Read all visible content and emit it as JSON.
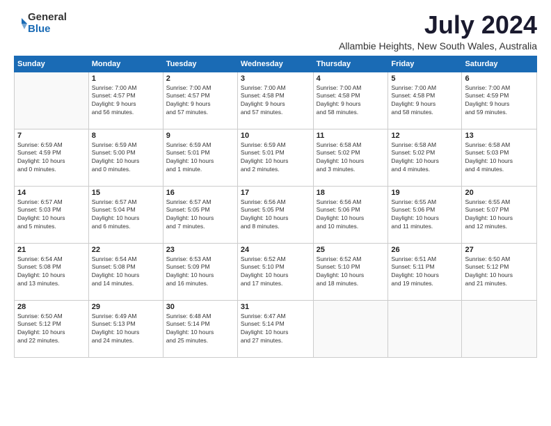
{
  "logo": {
    "general": "General",
    "blue": "Blue"
  },
  "title": "July 2024",
  "subtitle": "Allambie Heights, New South Wales, Australia",
  "weekdays": [
    "Sunday",
    "Monday",
    "Tuesday",
    "Wednesday",
    "Thursday",
    "Friday",
    "Saturday"
  ],
  "weeks": [
    [
      {
        "day": "",
        "info": ""
      },
      {
        "day": "1",
        "info": "Sunrise: 7:00 AM\nSunset: 4:57 PM\nDaylight: 9 hours\nand 56 minutes."
      },
      {
        "day": "2",
        "info": "Sunrise: 7:00 AM\nSunset: 4:57 PM\nDaylight: 9 hours\nand 57 minutes."
      },
      {
        "day": "3",
        "info": "Sunrise: 7:00 AM\nSunset: 4:58 PM\nDaylight: 9 hours\nand 57 minutes."
      },
      {
        "day": "4",
        "info": "Sunrise: 7:00 AM\nSunset: 4:58 PM\nDaylight: 9 hours\nand 58 minutes."
      },
      {
        "day": "5",
        "info": "Sunrise: 7:00 AM\nSunset: 4:58 PM\nDaylight: 9 hours\nand 58 minutes."
      },
      {
        "day": "6",
        "info": "Sunrise: 7:00 AM\nSunset: 4:59 PM\nDaylight: 9 hours\nand 59 minutes."
      }
    ],
    [
      {
        "day": "7",
        "info": "Sunrise: 6:59 AM\nSunset: 4:59 PM\nDaylight: 10 hours\nand 0 minutes."
      },
      {
        "day": "8",
        "info": "Sunrise: 6:59 AM\nSunset: 5:00 PM\nDaylight: 10 hours\nand 0 minutes."
      },
      {
        "day": "9",
        "info": "Sunrise: 6:59 AM\nSunset: 5:01 PM\nDaylight: 10 hours\nand 1 minute."
      },
      {
        "day": "10",
        "info": "Sunrise: 6:59 AM\nSunset: 5:01 PM\nDaylight: 10 hours\nand 2 minutes."
      },
      {
        "day": "11",
        "info": "Sunrise: 6:58 AM\nSunset: 5:02 PM\nDaylight: 10 hours\nand 3 minutes."
      },
      {
        "day": "12",
        "info": "Sunrise: 6:58 AM\nSunset: 5:02 PM\nDaylight: 10 hours\nand 4 minutes."
      },
      {
        "day": "13",
        "info": "Sunrise: 6:58 AM\nSunset: 5:03 PM\nDaylight: 10 hours\nand 4 minutes."
      }
    ],
    [
      {
        "day": "14",
        "info": "Sunrise: 6:57 AM\nSunset: 5:03 PM\nDaylight: 10 hours\nand 5 minutes."
      },
      {
        "day": "15",
        "info": "Sunrise: 6:57 AM\nSunset: 5:04 PM\nDaylight: 10 hours\nand 6 minutes."
      },
      {
        "day": "16",
        "info": "Sunrise: 6:57 AM\nSunset: 5:05 PM\nDaylight: 10 hours\nand 7 minutes."
      },
      {
        "day": "17",
        "info": "Sunrise: 6:56 AM\nSunset: 5:05 PM\nDaylight: 10 hours\nand 8 minutes."
      },
      {
        "day": "18",
        "info": "Sunrise: 6:56 AM\nSunset: 5:06 PM\nDaylight: 10 hours\nand 10 minutes."
      },
      {
        "day": "19",
        "info": "Sunrise: 6:55 AM\nSunset: 5:06 PM\nDaylight: 10 hours\nand 11 minutes."
      },
      {
        "day": "20",
        "info": "Sunrise: 6:55 AM\nSunset: 5:07 PM\nDaylight: 10 hours\nand 12 minutes."
      }
    ],
    [
      {
        "day": "21",
        "info": "Sunrise: 6:54 AM\nSunset: 5:08 PM\nDaylight: 10 hours\nand 13 minutes."
      },
      {
        "day": "22",
        "info": "Sunrise: 6:54 AM\nSunset: 5:08 PM\nDaylight: 10 hours\nand 14 minutes."
      },
      {
        "day": "23",
        "info": "Sunrise: 6:53 AM\nSunset: 5:09 PM\nDaylight: 10 hours\nand 16 minutes."
      },
      {
        "day": "24",
        "info": "Sunrise: 6:52 AM\nSunset: 5:10 PM\nDaylight: 10 hours\nand 17 minutes."
      },
      {
        "day": "25",
        "info": "Sunrise: 6:52 AM\nSunset: 5:10 PM\nDaylight: 10 hours\nand 18 minutes."
      },
      {
        "day": "26",
        "info": "Sunrise: 6:51 AM\nSunset: 5:11 PM\nDaylight: 10 hours\nand 19 minutes."
      },
      {
        "day": "27",
        "info": "Sunrise: 6:50 AM\nSunset: 5:12 PM\nDaylight: 10 hours\nand 21 minutes."
      }
    ],
    [
      {
        "day": "28",
        "info": "Sunrise: 6:50 AM\nSunset: 5:12 PM\nDaylight: 10 hours\nand 22 minutes."
      },
      {
        "day": "29",
        "info": "Sunrise: 6:49 AM\nSunset: 5:13 PM\nDaylight: 10 hours\nand 24 minutes."
      },
      {
        "day": "30",
        "info": "Sunrise: 6:48 AM\nSunset: 5:14 PM\nDaylight: 10 hours\nand 25 minutes."
      },
      {
        "day": "31",
        "info": "Sunrise: 6:47 AM\nSunset: 5:14 PM\nDaylight: 10 hours\nand 27 minutes."
      },
      {
        "day": "",
        "info": ""
      },
      {
        "day": "",
        "info": ""
      },
      {
        "day": "",
        "info": ""
      }
    ]
  ]
}
